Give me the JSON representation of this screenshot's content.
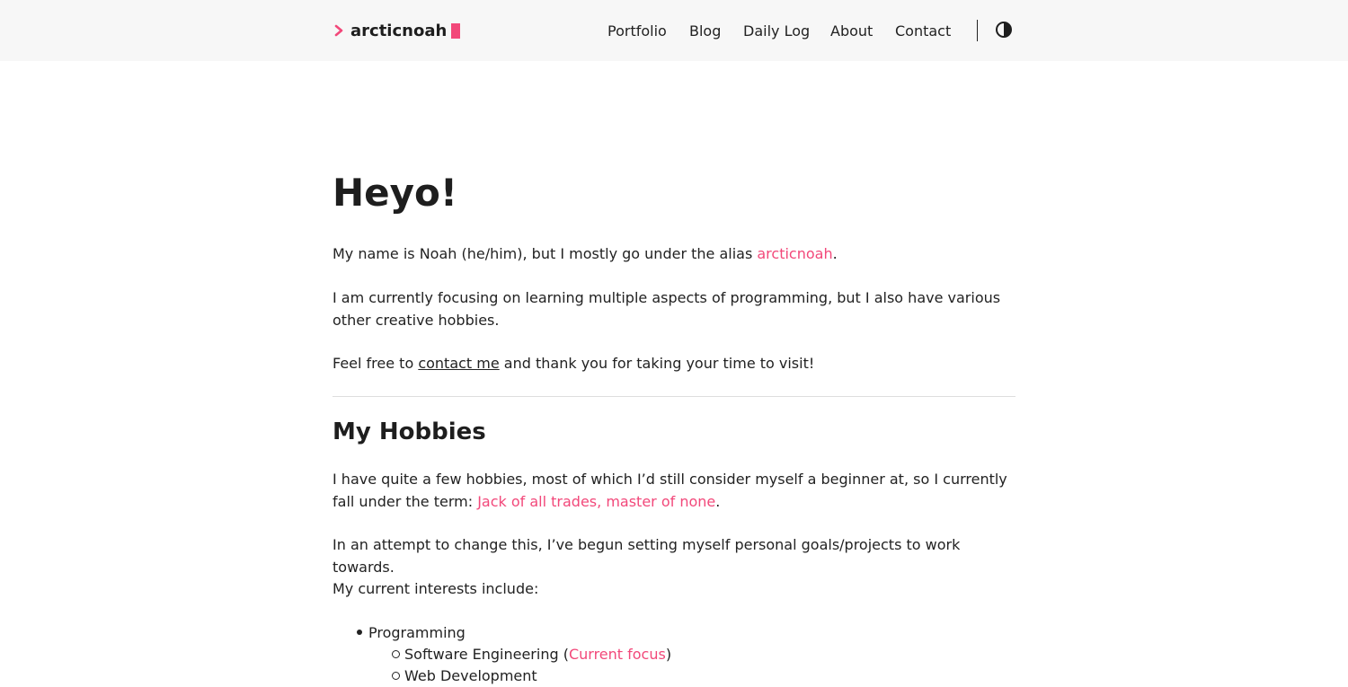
{
  "header": {
    "brand": "arcticnoah",
    "nav": [
      "Portfolio",
      "Blog",
      "Daily Log",
      "About",
      "Contact"
    ]
  },
  "intro": {
    "title": "Heyo!",
    "p1_before": "My name is Noah (he/him), but I mostly go under the alias ",
    "p1_link": "arcticnoah",
    "p1_after": ".",
    "p2": "I am currently focusing on learning multiple aspects of programming, but I also have various other creative hobbies.",
    "p3_before": "Feel free to ",
    "p3_link": "contact me",
    "p3_after": " and thank you for taking your time to visit!"
  },
  "hobbies": {
    "title": "My Hobbies",
    "p1_before": "I have quite a few hobbies, most of which I’d still consider myself a beginner at, so I currently fall under the term: ",
    "p1_link": "Jack of all trades, master of none",
    "p1_after": ".",
    "p2": "In an attempt to change this, I’ve begun setting myself personal goals/projects to work towards.",
    "p3": "My current interests include:",
    "list": {
      "item1": "Programming",
      "sub1_before": "Software Engineering (",
      "sub1_link": "Current focus",
      "sub1_after": ")",
      "sub2": "Web Development"
    }
  },
  "colors": {
    "accent": "#f2487a",
    "header_bg": "#f7f7f7",
    "text": "#222222"
  },
  "icons": {
    "brand_prompt": "chevron-right-icon",
    "theme_toggle": "half-circle-contrast-icon"
  }
}
